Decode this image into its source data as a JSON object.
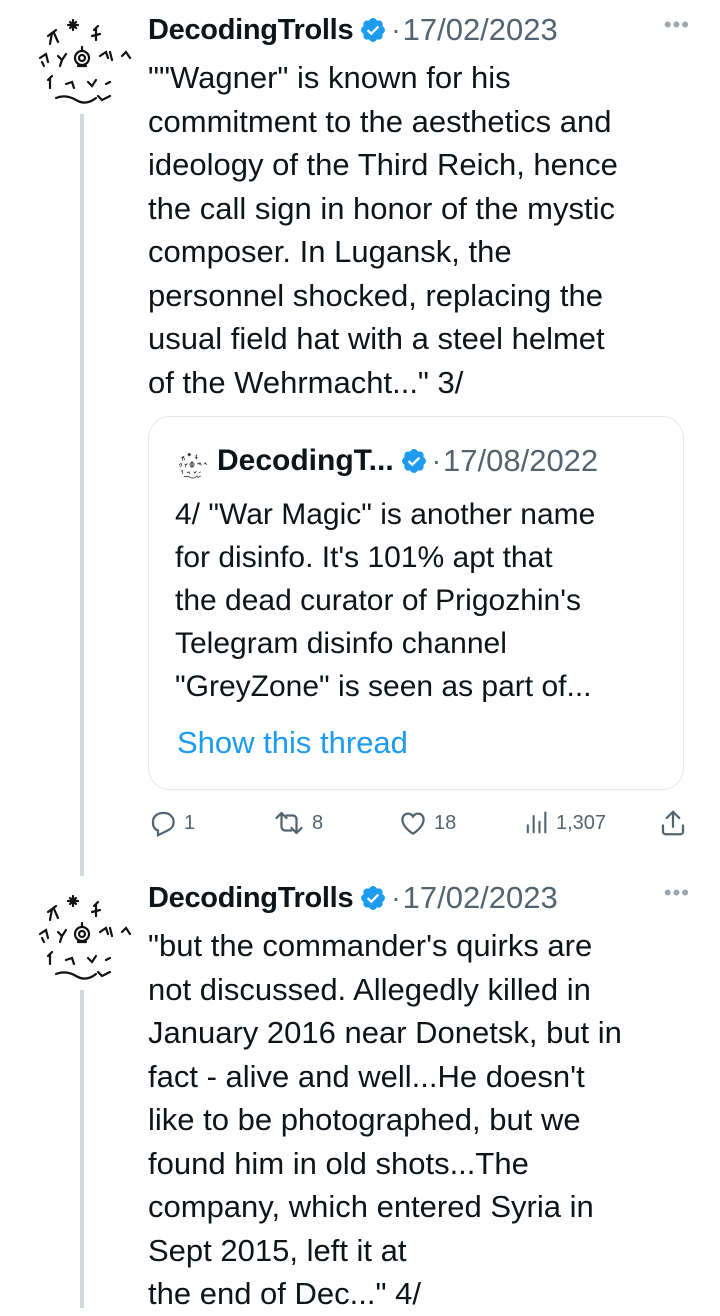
{
  "tweets": [
    {
      "author": "DecodingTrolls",
      "date": "17/02/2023",
      "text": "\"\"Wagner\" is known for his\ncommitment to the aesthetics and\nideology of the Third Reich, hence\nthe call sign in honor of the mystic\ncomposer. In Lugansk, the\npersonnel shocked, replacing the\nusual field hat with a steel helmet\nof the Wehrmacht...\" 3/",
      "quote": {
        "author": "DecodingT...",
        "date": "17/08/2022",
        "text": "4/ \"War Magic\" is another name\nfor disinfo. It's 101% apt that\nthe dead curator of Prigozhin's\nTelegram disinfo channel\n\"GreyZone\" is seen as part of...",
        "link": "Show this thread"
      },
      "stats": {
        "replies": "1",
        "retweets": "8",
        "likes": "18",
        "views": "1,307"
      }
    },
    {
      "author": "DecodingTrolls",
      "date": "17/02/2023",
      "text": "\"but the commander's quirks are\nnot discussed. Allegedly killed in\nJanuary 2016 near Donetsk, but in\nfact - alive and well...He doesn't\nlike to be photographed, but we\nfound him in old shots...The\ncompany, which entered Syria in\nSept 2015, left it at\nthe end of Dec...\" 4/"
    }
  ],
  "colors": {
    "accent": "#1d9bf0",
    "muted": "#536471",
    "border": "#e3e8eb",
    "thread": "#cfd9de"
  },
  "icons": [
    "verified-badge-icon",
    "more-icon",
    "reply-icon",
    "retweet-icon",
    "like-icon",
    "views-icon",
    "share-icon"
  ]
}
